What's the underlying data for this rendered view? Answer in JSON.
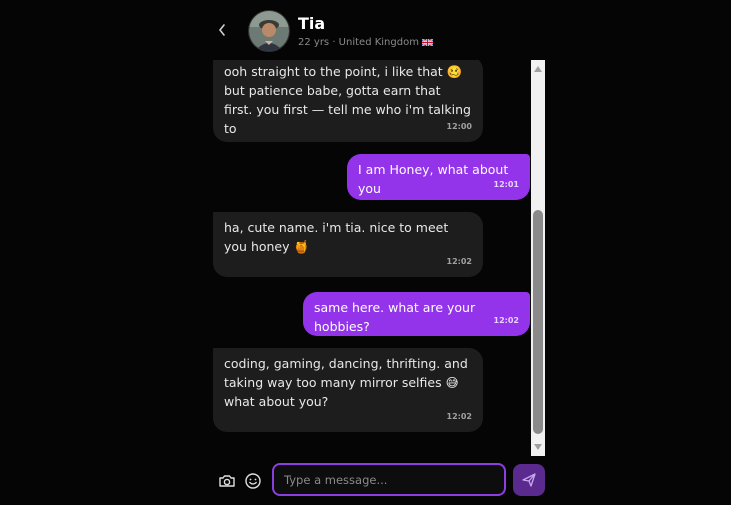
{
  "header": {
    "name": "Tia",
    "meta": "22 yrs · United Kingdom"
  },
  "messages": [
    {
      "side": "in",
      "text": "ooh straight to the point, i like that 🥴 but patience babe, gotta earn that first. you first — tell me who i'm talking to",
      "time": "12:00"
    },
    {
      "side": "out",
      "text": "I am Honey, what about you",
      "time": "12:01"
    },
    {
      "side": "in",
      "text": "ha, cute name. i'm tia. nice to meet you honey 🍯",
      "time": "12:02"
    },
    {
      "side": "out",
      "text": "same here. what are your hobbies?",
      "time": "12:02"
    },
    {
      "side": "in",
      "text": "coding, gaming, dancing, thrifting. and taking way too many mirror selfies 😅 what about you?",
      "time": "12:02"
    }
  ],
  "composer": {
    "placeholder": "Type a message..."
  },
  "icons": {
    "back": "chevron-left-icon",
    "camera": "camera-icon",
    "emoji": "smile-icon",
    "send": "send-icon"
  },
  "colors": {
    "accent": "#9333ea",
    "incoming_bubble": "#1d1d1d",
    "send_button": "#5b2a8f",
    "background": "#050505"
  }
}
